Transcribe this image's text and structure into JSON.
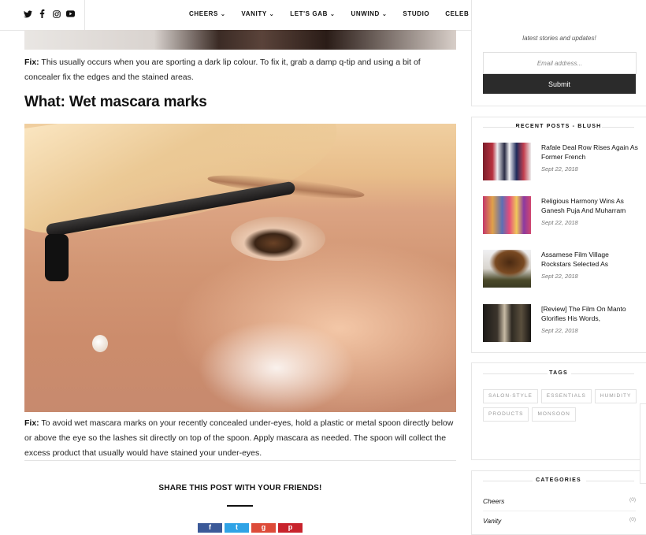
{
  "nav": {
    "social_icons": [
      "twitter-icon",
      "facebook-icon",
      "instagram-icon",
      "youtube-icon"
    ],
    "items": [
      {
        "label": "CHEERS",
        "has_dropdown": true
      },
      {
        "label": "VANITY",
        "has_dropdown": true
      },
      {
        "label": "LET'S GAB",
        "has_dropdown": true
      },
      {
        "label": "UNWIND",
        "has_dropdown": true
      },
      {
        "label": "STUDIO",
        "has_dropdown": false
      },
      {
        "label": "CELEB SPEAKS",
        "has_dropdown": true
      }
    ]
  },
  "article": {
    "fix1_label": "Fix:",
    "fix1_text": "This usually occurs when you are sporting a dark lip colour. To fix it, grab a damp q-tip and using a bit of concealer fix the edges and the stained areas.",
    "heading": "What: Wet mascara marks",
    "fix2_label": "Fix:",
    "fix2_text": "To avoid wet mascara marks on your recently concealed under-eyes, hold a plastic or metal spoon directly below or above the eye so the lashes sit directly on top of the spoon. Apply mascara as needed. The spoon will collect the excess product that usually would have stained your under-eyes.",
    "share_title": "SHARE THIS POST WITH YOUR FRIENDS!",
    "share_buttons": [
      {
        "name": "facebook",
        "glyph": "f",
        "color": "#3b5998"
      },
      {
        "name": "twitter",
        "glyph": "t",
        "color": "#2fa3e6"
      },
      {
        "name": "google-plus",
        "glyph": "g",
        "color": "#dd4b39"
      },
      {
        "name": "pinterest",
        "glyph": "p",
        "color": "#c8232c"
      }
    ]
  },
  "sidebar": {
    "newsletter_text": "latest stories and updates!",
    "email_placeholder": "Email address...",
    "submit_label": "Submit",
    "recent_title": "RECENT POSTS - BLUSH",
    "recent_posts": [
      {
        "title": "Rafale Deal Row Rises Again As Former French",
        "date": "Sept 22, 2018"
      },
      {
        "title": "Religious Harmony Wins As Ganesh Puja And Muharram",
        "date": "Sept 22, 2018"
      },
      {
        "title": "Assamese Film Village Rockstars Selected As",
        "date": "Sept 22, 2018"
      },
      {
        "title": "[Review] The Film On Manto Glorifies His Words,",
        "date": "Sept 22, 2018"
      }
    ],
    "tags_title": "TAGS",
    "tags": [
      "SALON-STYLE",
      "ESSENTIALS",
      "HUMIDITY",
      "PRODUCTS",
      "MONSOON"
    ],
    "categories_title": "CATEGORIES",
    "categories": [
      {
        "name": "Cheers",
        "count": "(0)"
      },
      {
        "name": "Vanity",
        "count": "(0)"
      }
    ]
  }
}
